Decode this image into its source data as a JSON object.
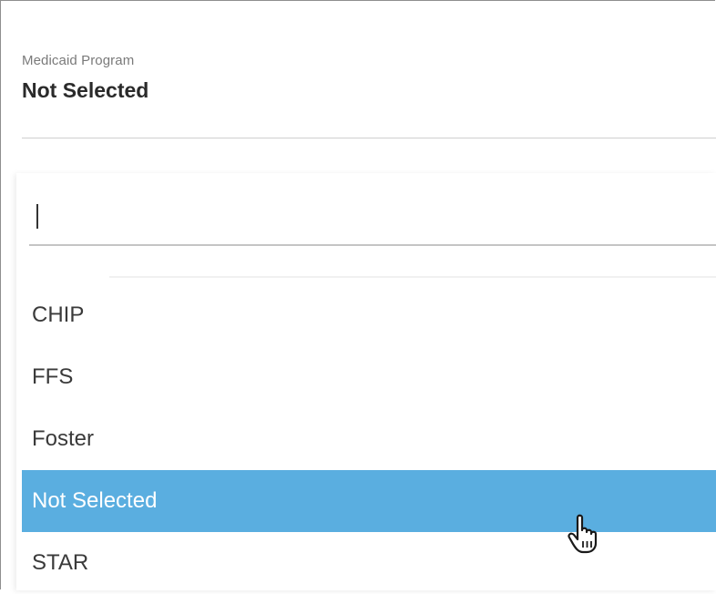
{
  "field": {
    "label": "Medicaid Program",
    "value": "Not Selected"
  },
  "search": {
    "value": ""
  },
  "options": [
    {
      "label": "CHIP",
      "selected": false
    },
    {
      "label": "FFS",
      "selected": false
    },
    {
      "label": "Foster",
      "selected": false
    },
    {
      "label": "Not Selected",
      "selected": true
    },
    {
      "label": "STAR",
      "selected": false
    }
  ],
  "colors": {
    "selected_background": "#5aaee0",
    "selected_text": "#ffffff"
  },
  "cursor": {
    "icon": "hand-pointer-icon"
  }
}
